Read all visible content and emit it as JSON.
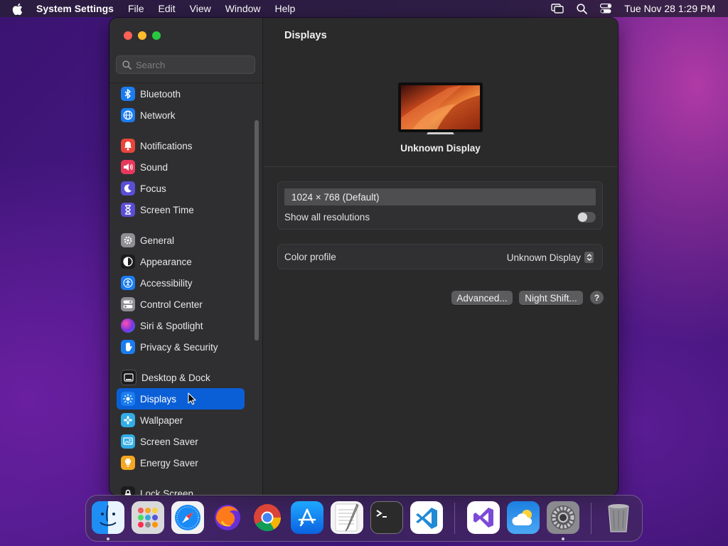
{
  "menubar": {
    "app_name": "System Settings",
    "menus": [
      "File",
      "Edit",
      "View",
      "Window",
      "Help"
    ],
    "clock": "Tue Nov 28  1:29 PM"
  },
  "sidebar": {
    "search_placeholder": "Search",
    "items": [
      {
        "label": "Bluetooth",
        "icon": "bluetooth-icon",
        "color": "#1a7cf0"
      },
      {
        "label": "Network",
        "icon": "globe-icon",
        "color": "#1a7cf0"
      },
      {
        "label": "Notifications",
        "icon": "bell-icon",
        "color": "#e8453c"
      },
      {
        "label": "Sound",
        "icon": "speaker-icon",
        "color": "#e8385c"
      },
      {
        "label": "Focus",
        "icon": "moon-icon",
        "color": "#5b4ed6"
      },
      {
        "label": "Screen Time",
        "icon": "hourglass-icon",
        "color": "#5b4ed6"
      },
      {
        "label": "General",
        "icon": "gear-icon",
        "color": "#8e8e93"
      },
      {
        "label": "Appearance",
        "icon": "appearance-icon",
        "color": "#1c1c1e"
      },
      {
        "label": "Accessibility",
        "icon": "accessibility-icon",
        "color": "#1a7cf0"
      },
      {
        "label": "Control Center",
        "icon": "control-center-icon",
        "color": "#8e8e93"
      },
      {
        "label": "Siri & Spotlight",
        "icon": "siri-icon",
        "color": "#9b3ad6"
      },
      {
        "label": "Privacy & Security",
        "icon": "hand-icon",
        "color": "#1a7cf0"
      },
      {
        "label": "Desktop & Dock",
        "icon": "dock-icon",
        "color": "#1c1c1e"
      },
      {
        "label": "Displays",
        "icon": "sun-icon",
        "color": "#1a7cf0"
      },
      {
        "label": "Wallpaper",
        "icon": "wallpaper-icon",
        "color": "#32ade6"
      },
      {
        "label": "Screen Saver",
        "icon": "screensaver-icon",
        "color": "#32ade6"
      },
      {
        "label": "Energy Saver",
        "icon": "bulb-icon",
        "color": "#f5a623"
      },
      {
        "label": "Lock Screen",
        "icon": "lock-icon",
        "color": "#1c1c1e"
      }
    ]
  },
  "main": {
    "title": "Displays",
    "display_name": "Unknown Display",
    "resolution": "1024 × 768 (Default)",
    "show_all_label": "Show all resolutions",
    "show_all_on": false,
    "color_profile_label": "Color profile",
    "color_profile_value": "Unknown Display",
    "advanced_label": "Advanced...",
    "night_shift_label": "Night Shift...",
    "help_label": "?"
  },
  "dock": {
    "apps": [
      "Finder",
      "Launchpad",
      "Safari",
      "Firefox",
      "Chrome",
      "App Store",
      "TextEdit",
      "Terminal",
      "Visual Studio Code",
      "Visual Studio",
      "Weather",
      "System Settings",
      "Trash"
    ]
  },
  "colors": {
    "accent": "#0a5fd6",
    "window_bg": "#2a2a2b",
    "sidebar_bg": "#2f2f31"
  }
}
